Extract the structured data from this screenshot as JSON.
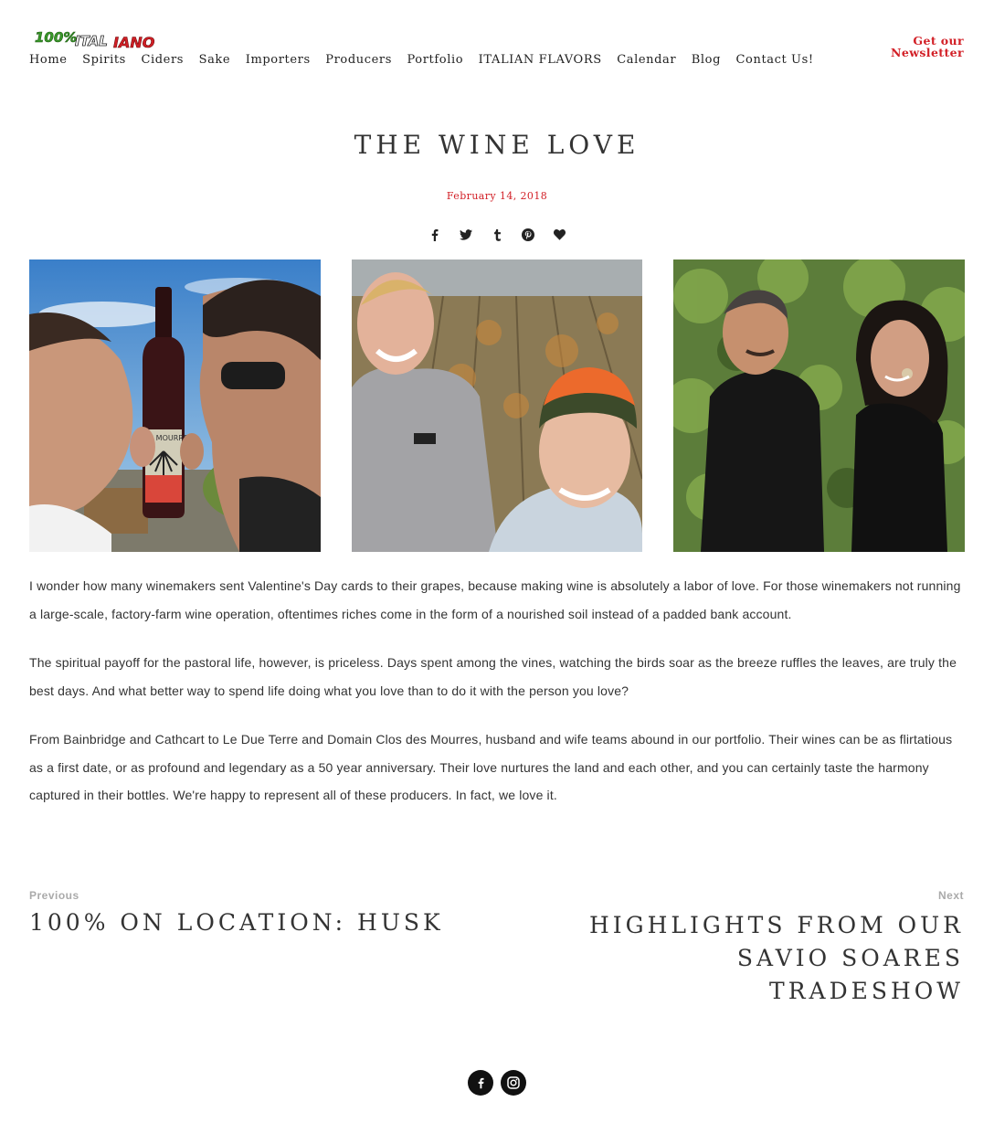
{
  "header": {
    "logo_alt": "100% ITALIANO",
    "nav": [
      "Home",
      "Spirits",
      "Ciders",
      "Sake",
      "Importers",
      "Producers",
      "Portfolio",
      "ITALIAN FLAVORS",
      "Calendar",
      "Blog",
      "Contact Us!"
    ],
    "newsletter_line1": "Get our",
    "newsletter_line2": "Newsletter",
    "accent_color": "#d21f26"
  },
  "post": {
    "title": "THE WINE LOVE",
    "date": "February 14, 2018",
    "share_icons": [
      "facebook-icon",
      "twitter-icon",
      "tumblr-icon",
      "pinterest-icon",
      "heart-icon"
    ],
    "photo_bottle_label": "CLOS MOURRES",
    "paragraphs": [
      "I wonder how many winemakers sent Valentine's Day cards to their grapes, because making wine is absolutely a labor of love. For those winemakers not running a large-scale, factory-farm wine operation, oftentimes riches come in the form of a nourished soil instead of a padded bank account.",
      "The spiritual payoff for the pastoral life, however, is priceless. Days spent among the vines, watching the birds soar as the breeze ruffles the leaves, are truly the best days. And what better way to spend life doing what you love than to do it with the person you love?",
      "From Bainbridge and Cathcart to Le Due Terre and Domain Clos des Mourres, husband and wife teams abound in our portfolio. Their wines can be as flirtatious as a first date, or as profound and legendary as a 50 year anniversary. Their love nurtures the land and each other, and you can certainly taste the harmony captured in their bottles. We're happy to represent all of these producers. In fact, we love it."
    ]
  },
  "post_nav": {
    "previous_label": "Previous",
    "previous_title": "100% ON LOCATION: HUSK",
    "next_label": "Next",
    "next_title": "HIGHLIGHTS FROM OUR SAVIO SOARES TRADESHOW"
  },
  "footer": {
    "social_icons": [
      "facebook-icon",
      "instagram-icon"
    ]
  }
}
